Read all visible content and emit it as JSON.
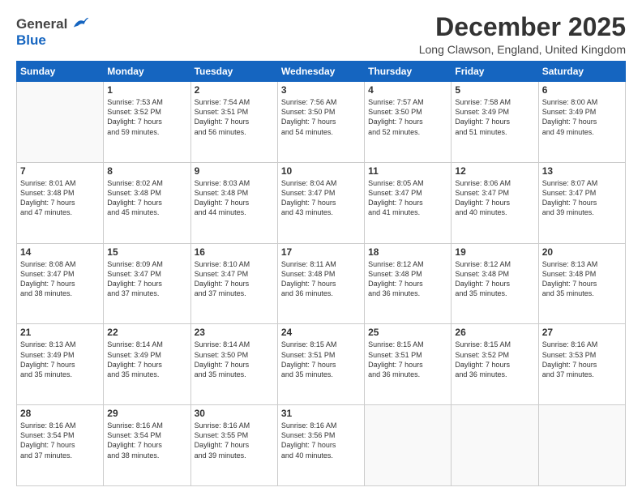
{
  "logo": {
    "general": "General",
    "blue": "Blue"
  },
  "header": {
    "month": "December 2025",
    "location": "Long Clawson, England, United Kingdom"
  },
  "days": [
    "Sunday",
    "Monday",
    "Tuesday",
    "Wednesday",
    "Thursday",
    "Friday",
    "Saturday"
  ],
  "weeks": [
    [
      {
        "day": "",
        "info": ""
      },
      {
        "day": "1",
        "info": "Sunrise: 7:53 AM\nSunset: 3:52 PM\nDaylight: 7 hours\nand 59 minutes."
      },
      {
        "day": "2",
        "info": "Sunrise: 7:54 AM\nSunset: 3:51 PM\nDaylight: 7 hours\nand 56 minutes."
      },
      {
        "day": "3",
        "info": "Sunrise: 7:56 AM\nSunset: 3:50 PM\nDaylight: 7 hours\nand 54 minutes."
      },
      {
        "day": "4",
        "info": "Sunrise: 7:57 AM\nSunset: 3:50 PM\nDaylight: 7 hours\nand 52 minutes."
      },
      {
        "day": "5",
        "info": "Sunrise: 7:58 AM\nSunset: 3:49 PM\nDaylight: 7 hours\nand 51 minutes."
      },
      {
        "day": "6",
        "info": "Sunrise: 8:00 AM\nSunset: 3:49 PM\nDaylight: 7 hours\nand 49 minutes."
      }
    ],
    [
      {
        "day": "7",
        "info": "Sunrise: 8:01 AM\nSunset: 3:48 PM\nDaylight: 7 hours\nand 47 minutes."
      },
      {
        "day": "8",
        "info": "Sunrise: 8:02 AM\nSunset: 3:48 PM\nDaylight: 7 hours\nand 45 minutes."
      },
      {
        "day": "9",
        "info": "Sunrise: 8:03 AM\nSunset: 3:48 PM\nDaylight: 7 hours\nand 44 minutes."
      },
      {
        "day": "10",
        "info": "Sunrise: 8:04 AM\nSunset: 3:47 PM\nDaylight: 7 hours\nand 43 minutes."
      },
      {
        "day": "11",
        "info": "Sunrise: 8:05 AM\nSunset: 3:47 PM\nDaylight: 7 hours\nand 41 minutes."
      },
      {
        "day": "12",
        "info": "Sunrise: 8:06 AM\nSunset: 3:47 PM\nDaylight: 7 hours\nand 40 minutes."
      },
      {
        "day": "13",
        "info": "Sunrise: 8:07 AM\nSunset: 3:47 PM\nDaylight: 7 hours\nand 39 minutes."
      }
    ],
    [
      {
        "day": "14",
        "info": "Sunrise: 8:08 AM\nSunset: 3:47 PM\nDaylight: 7 hours\nand 38 minutes."
      },
      {
        "day": "15",
        "info": "Sunrise: 8:09 AM\nSunset: 3:47 PM\nDaylight: 7 hours\nand 37 minutes."
      },
      {
        "day": "16",
        "info": "Sunrise: 8:10 AM\nSunset: 3:47 PM\nDaylight: 7 hours\nand 37 minutes."
      },
      {
        "day": "17",
        "info": "Sunrise: 8:11 AM\nSunset: 3:48 PM\nDaylight: 7 hours\nand 36 minutes."
      },
      {
        "day": "18",
        "info": "Sunrise: 8:12 AM\nSunset: 3:48 PM\nDaylight: 7 hours\nand 36 minutes."
      },
      {
        "day": "19",
        "info": "Sunrise: 8:12 AM\nSunset: 3:48 PM\nDaylight: 7 hours\nand 35 minutes."
      },
      {
        "day": "20",
        "info": "Sunrise: 8:13 AM\nSunset: 3:48 PM\nDaylight: 7 hours\nand 35 minutes."
      }
    ],
    [
      {
        "day": "21",
        "info": "Sunrise: 8:13 AM\nSunset: 3:49 PM\nDaylight: 7 hours\nand 35 minutes."
      },
      {
        "day": "22",
        "info": "Sunrise: 8:14 AM\nSunset: 3:49 PM\nDaylight: 7 hours\nand 35 minutes."
      },
      {
        "day": "23",
        "info": "Sunrise: 8:14 AM\nSunset: 3:50 PM\nDaylight: 7 hours\nand 35 minutes."
      },
      {
        "day": "24",
        "info": "Sunrise: 8:15 AM\nSunset: 3:51 PM\nDaylight: 7 hours\nand 35 minutes."
      },
      {
        "day": "25",
        "info": "Sunrise: 8:15 AM\nSunset: 3:51 PM\nDaylight: 7 hours\nand 36 minutes."
      },
      {
        "day": "26",
        "info": "Sunrise: 8:15 AM\nSunset: 3:52 PM\nDaylight: 7 hours\nand 36 minutes."
      },
      {
        "day": "27",
        "info": "Sunrise: 8:16 AM\nSunset: 3:53 PM\nDaylight: 7 hours\nand 37 minutes."
      }
    ],
    [
      {
        "day": "28",
        "info": "Sunrise: 8:16 AM\nSunset: 3:54 PM\nDaylight: 7 hours\nand 37 minutes."
      },
      {
        "day": "29",
        "info": "Sunrise: 8:16 AM\nSunset: 3:54 PM\nDaylight: 7 hours\nand 38 minutes."
      },
      {
        "day": "30",
        "info": "Sunrise: 8:16 AM\nSunset: 3:55 PM\nDaylight: 7 hours\nand 39 minutes."
      },
      {
        "day": "31",
        "info": "Sunrise: 8:16 AM\nSunset: 3:56 PM\nDaylight: 7 hours\nand 40 minutes."
      },
      {
        "day": "",
        "info": ""
      },
      {
        "day": "",
        "info": ""
      },
      {
        "day": "",
        "info": ""
      }
    ]
  ]
}
